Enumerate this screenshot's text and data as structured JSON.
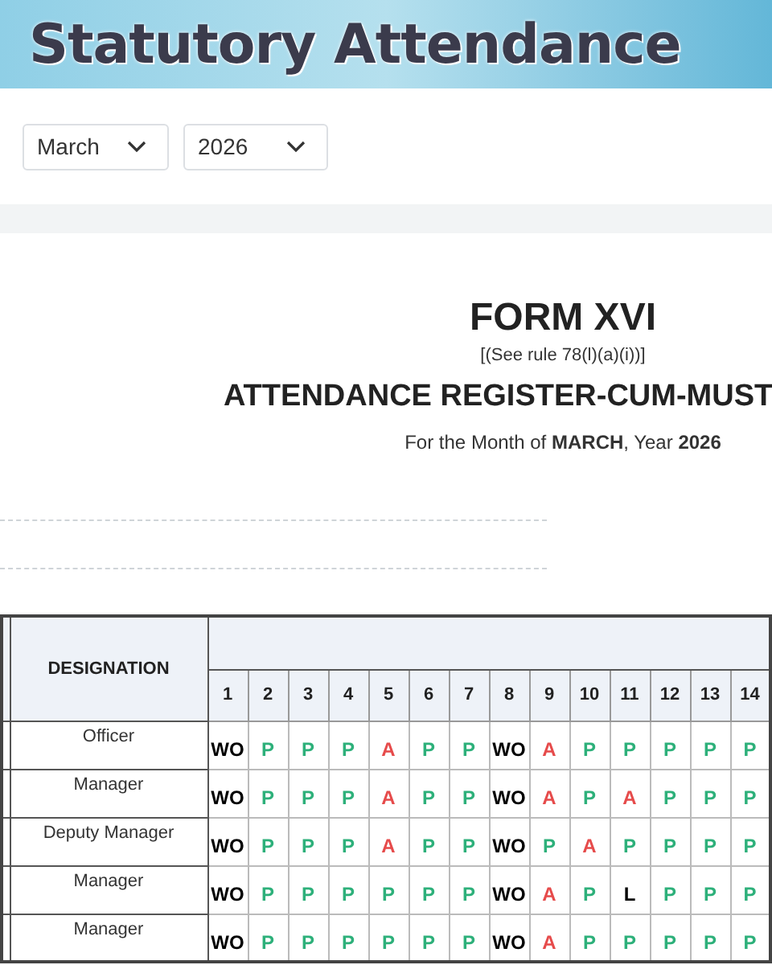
{
  "banner": {
    "title": "Statutory Attendance"
  },
  "filters": [
    {
      "value": "March"
    },
    {
      "value": "2026"
    }
  ],
  "form": {
    "title": "FORM XVI",
    "rule": "[(See rule 78(l)(a)(i))]",
    "heading": "ATTENDANCE REGISTER-CUM-MUST",
    "period": "For the Month of **MARCH**, Year **2026**"
  },
  "table": {
    "columns": [
      {
        "label": "DESIGNATION"
      },
      {
        "label": "1"
      },
      {
        "label": "2"
      },
      {
        "label": "3"
      },
      {
        "label": "4"
      },
      {
        "label": "5"
      },
      {
        "label": "6"
      },
      {
        "label": "7"
      },
      {
        "label": "8"
      },
      {
        "label": "9"
      },
      {
        "label": "10"
      },
      {
        "label": "11"
      },
      {
        "label": "12"
      },
      {
        "label": "13"
      },
      {
        "label": "14"
      }
    ],
    "rows": [
      {
        "designation": "Officer",
        "days": [
          {
            "text": "WO",
            "kind": "weekoff"
          },
          {
            "text": "P",
            "kind": "present"
          },
          {
            "text": "P",
            "kind": "present"
          },
          {
            "text": "P",
            "kind": "present"
          },
          {
            "text": "A",
            "kind": "absent"
          },
          {
            "text": "P",
            "kind": "present"
          },
          {
            "text": "P",
            "kind": "present"
          },
          {
            "text": "WO",
            "kind": "weekoff"
          },
          {
            "text": "A",
            "kind": "absent"
          },
          {
            "text": "P",
            "kind": "present"
          },
          {
            "text": "P",
            "kind": "present"
          },
          {
            "text": "P",
            "kind": "present"
          },
          {
            "text": "P",
            "kind": "present"
          },
          {
            "text": "P",
            "kind": "present"
          }
        ]
      },
      {
        "designation": "Manager",
        "days": [
          {
            "text": "WO",
            "kind": "weekoff"
          },
          {
            "text": "P",
            "kind": "present"
          },
          {
            "text": "P",
            "kind": "present"
          },
          {
            "text": "P",
            "kind": "present"
          },
          {
            "text": "A",
            "kind": "absent"
          },
          {
            "text": "P",
            "kind": "present"
          },
          {
            "text": "P",
            "kind": "present"
          },
          {
            "text": "WO",
            "kind": "weekoff"
          },
          {
            "text": "A",
            "kind": "absent"
          },
          {
            "text": "P",
            "kind": "present"
          },
          {
            "text": "A",
            "kind": "absent"
          },
          {
            "text": "P",
            "kind": "present"
          },
          {
            "text": "P",
            "kind": "present"
          },
          {
            "text": "P",
            "kind": "present"
          }
        ]
      },
      {
        "designation": "Deputy Manager",
        "days": [
          {
            "text": "WO",
            "kind": "weekoff"
          },
          {
            "text": "P",
            "kind": "present"
          },
          {
            "text": "P",
            "kind": "present"
          },
          {
            "text": "P",
            "kind": "present"
          },
          {
            "text": "A",
            "kind": "absent"
          },
          {
            "text": "P",
            "kind": "present"
          },
          {
            "text": "P",
            "kind": "present"
          },
          {
            "text": "WO",
            "kind": "weekoff"
          },
          {
            "text": "P",
            "kind": "present"
          },
          {
            "text": "A",
            "kind": "absent"
          },
          {
            "text": "P",
            "kind": "present"
          },
          {
            "text": "P",
            "kind": "present"
          },
          {
            "text": "P",
            "kind": "present"
          },
          {
            "text": "P",
            "kind": "present"
          }
        ]
      },
      {
        "designation": "Manager",
        "days": [
          {
            "text": "WO",
            "kind": "weekoff"
          },
          {
            "text": "P",
            "kind": "present"
          },
          {
            "text": "P",
            "kind": "present"
          },
          {
            "text": "P",
            "kind": "present"
          },
          {
            "text": "P",
            "kind": "present"
          },
          {
            "text": "P",
            "kind": "present"
          },
          {
            "text": "P",
            "kind": "present"
          },
          {
            "text": "WO",
            "kind": "weekoff"
          },
          {
            "text": "A",
            "kind": "absent"
          },
          {
            "text": "P",
            "kind": "present"
          },
          {
            "text": "L",
            "kind": "leave"
          },
          {
            "text": "P",
            "kind": "present"
          },
          {
            "text": "P",
            "kind": "present"
          },
          {
            "text": "P",
            "kind": "present"
          }
        ]
      },
      {
        "designation": "Manager",
        "days": [
          {
            "text": "WO",
            "kind": "weekoff"
          },
          {
            "text": "P",
            "kind": "present"
          },
          {
            "text": "P",
            "kind": "present"
          },
          {
            "text": "P",
            "kind": "present"
          },
          {
            "text": "P",
            "kind": "present"
          },
          {
            "text": "P",
            "kind": "present"
          },
          {
            "text": "P",
            "kind": "present"
          },
          {
            "text": "WO",
            "kind": "weekoff"
          },
          {
            "text": "A",
            "kind": "absent"
          },
          {
            "text": "P",
            "kind": "present"
          },
          {
            "text": "P",
            "kind": "present"
          },
          {
            "text": "P",
            "kind": "present"
          },
          {
            "text": "P",
            "kind": "present"
          },
          {
            "text": "P",
            "kind": "present"
          }
        ]
      }
    ]
  }
}
